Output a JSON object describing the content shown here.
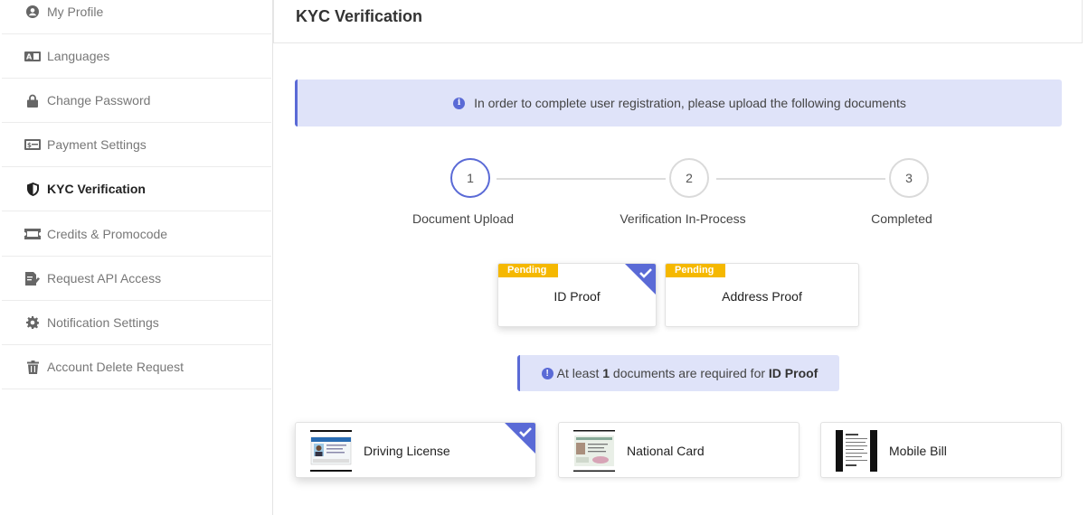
{
  "sidebar": {
    "items": [
      {
        "label": "My Profile",
        "icon": "user-circle-icon"
      },
      {
        "label": "Languages",
        "icon": "language-icon"
      },
      {
        "label": "Change Password",
        "icon": "lock-icon"
      },
      {
        "label": "Payment Settings",
        "icon": "money-icon"
      },
      {
        "label": "KYC Verification",
        "icon": "shield-icon"
      },
      {
        "label": "Credits & Promocode",
        "icon": "ticket-icon"
      },
      {
        "label": "Request API Access",
        "icon": "edit-doc-icon"
      },
      {
        "label": "Notification Settings",
        "icon": "gear-icon"
      },
      {
        "label": "Account Delete Request",
        "icon": "trash-icon"
      }
    ],
    "active_index": 4
  },
  "header": {
    "title": "KYC Verification"
  },
  "info_banner": {
    "text": "In order to complete user registration, please upload the following documents"
  },
  "stepper": {
    "steps": [
      {
        "number": "1",
        "label": "Document Upload"
      },
      {
        "number": "2",
        "label": "Verification In-Process"
      },
      {
        "number": "3",
        "label": "Completed"
      }
    ],
    "active_step": 1
  },
  "proofs": [
    {
      "label": "ID Proof",
      "status": "Pending",
      "selected": true
    },
    {
      "label": "Address Proof",
      "status": "Pending",
      "selected": false
    }
  ],
  "requirement": {
    "prefix": "At least",
    "count": "1",
    "middle": "documents are required for",
    "target": "ID Proof"
  },
  "documents": [
    {
      "label": "Driving License",
      "selected": true,
      "thumb": "license-card-image"
    },
    {
      "label": "National Card",
      "selected": false,
      "thumb": "national-card-image"
    },
    {
      "label": "Mobile Bill",
      "selected": false,
      "thumb": "bill-document-image"
    }
  ],
  "colors": {
    "accent": "#5a6ad6",
    "banner_bg": "#dfe3f9",
    "pending": "#f5b800"
  }
}
